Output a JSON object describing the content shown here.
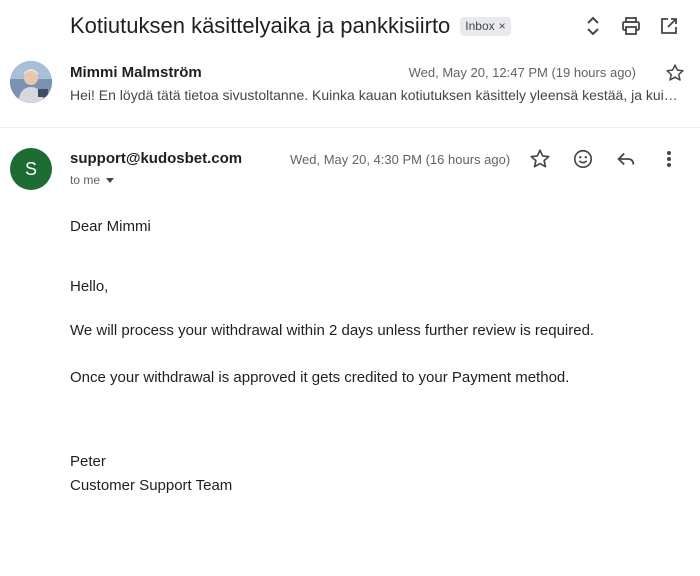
{
  "thread": {
    "subject": "Kotiutuksen käsittelyaika ja pankkisiirto",
    "label": "Inbox",
    "label_remove": "×"
  },
  "toolbar": {
    "icons": [
      "expand-collapse-icon",
      "print-icon",
      "open-in-new-window-icon"
    ]
  },
  "collapsed_message": {
    "sender": "Mimmi Malmström",
    "date": "Wed, May 20, 12:47 PM (19 hours ago)",
    "snippet": "Hei! En löydä tätä tietoa sivustoltanne. Kuinka kauan kotiutuksen käsittely yleensä kestää, ja kuinka kauan kestää, että rahat ovat tililläni?",
    "icons": [
      "avatar-photo",
      "star-icon"
    ]
  },
  "expanded_message": {
    "avatar_letter": "S",
    "avatar_color": "#1e6b34",
    "from": "support@kudosbet.com",
    "to": "to me",
    "date": "Wed, May 20, 4:30 PM (16 hours ago)",
    "icons": [
      "star-icon",
      "emoji-reaction-icon",
      "reply-icon",
      "more-options-icon"
    ],
    "body": {
      "greeting": "Dear Mimmi",
      "hello": "Hello,",
      "paragraph1": "We will process your withdrawal within 2 days unless further review is required.",
      "paragraph2": "Once your withdrawal is approved it gets credited to your Payment method.",
      "signature_name": "Peter",
      "signature_team": "Customer Support Team"
    }
  }
}
